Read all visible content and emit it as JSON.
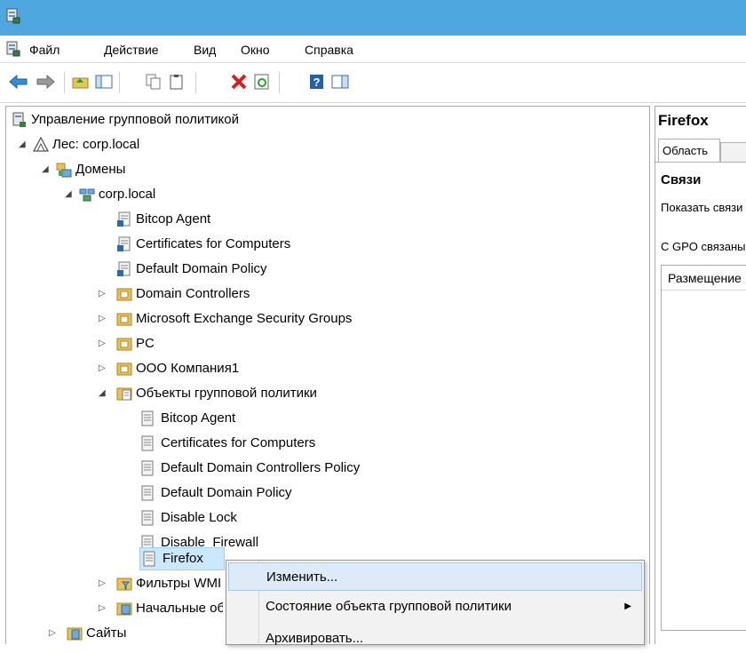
{
  "menubar": {
    "items": [
      "Файл",
      "Действие",
      "Вид",
      "Окно",
      "Справка"
    ]
  },
  "tree": {
    "root": "Управление групповой политикой",
    "forest": "Лес: corp.local",
    "domains": "Домены",
    "domain": "corp.local",
    "links": [
      "Bitcop Agent",
      "Certificates for Computers",
      "Default Domain Policy"
    ],
    "ous": [
      "Domain Controllers",
      "Microsoft Exchange Security Groups",
      "PC",
      "ООО Компания1"
    ],
    "gpo_container": "Объекты групповой политики",
    "gpos": [
      "Bitcop Agent",
      "Certificates for Computers",
      "Default Domain Controllers Policy",
      "Default Domain Policy",
      "Disable Lock",
      "Disable_Firewall",
      "Firefox"
    ],
    "wmi": "Фильтры WMI",
    "starter": "Начальные объекты групповой политики",
    "sites": "Сайты"
  },
  "right": {
    "title": "Firefox",
    "tab_scope": "Область",
    "links_header": "Связи",
    "show_label": "Показать связи в этом расположении:",
    "gpo_linked": "С GPO связаны следующие сайты, домены и подразделения:",
    "col_location": "Размещение"
  },
  "context_menu": {
    "items": [
      "Изменить...",
      "Состояние объекта групповой политики",
      "Архивировать..."
    ]
  }
}
